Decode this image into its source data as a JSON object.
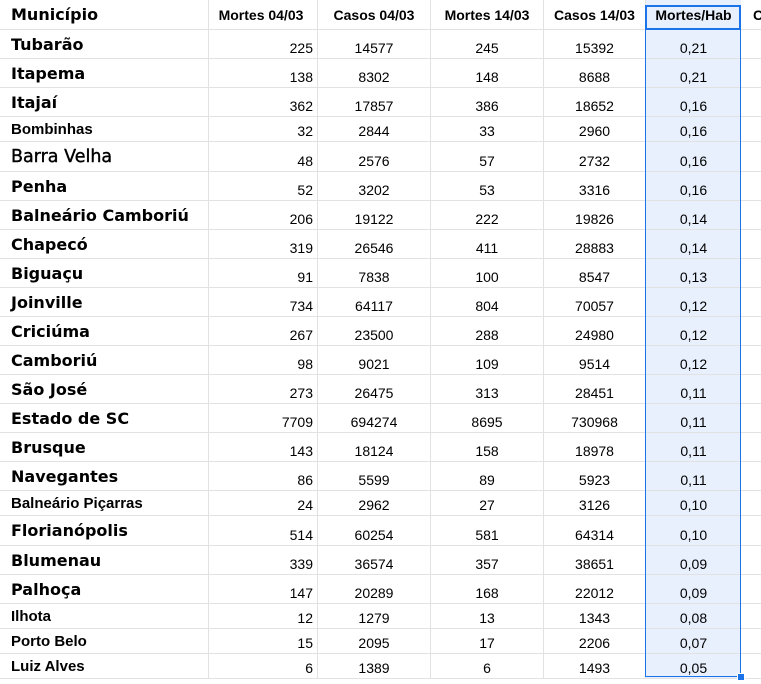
{
  "table": {
    "headers": {
      "municipio": "Município",
      "mortes_0403": "Mortes 04/03",
      "casos_0403": "Casos 04/03",
      "mortes_1403": "Mortes 14/03",
      "casos_1403": "Casos 14/03",
      "mortes_hab": "Mortes/Hab",
      "next": "C"
    },
    "rows": [
      {
        "municipio": "Tubarão",
        "mortes_0403": "225",
        "casos_0403": "14577",
        "mortes_1403": "245",
        "casos_1403": "15392",
        "mortes_hab": "0,21"
      },
      {
        "municipio": "Itapema",
        "mortes_0403": "138",
        "casos_0403": "8302",
        "mortes_1403": "148",
        "casos_1403": "8688",
        "mortes_hab": "0,21"
      },
      {
        "municipio": "Itajaí",
        "mortes_0403": "362",
        "casos_0403": "17857",
        "mortes_1403": "386",
        "casos_1403": "18652",
        "mortes_hab": "0,16"
      },
      {
        "municipio": "Bombinhas",
        "mortes_0403": "32",
        "casos_0403": "2844",
        "mortes_1403": "33",
        "casos_1403": "2960",
        "mortes_hab": "0,16"
      },
      {
        "municipio": "Barra Velha",
        "mortes_0403": "48",
        "casos_0403": "2576",
        "mortes_1403": "57",
        "casos_1403": "2732",
        "mortes_hab": "0,16"
      },
      {
        "municipio": "Penha",
        "mortes_0403": "52",
        "casos_0403": "3202",
        "mortes_1403": "53",
        "casos_1403": "3316",
        "mortes_hab": "0,16"
      },
      {
        "municipio": "Balneário Camboriú",
        "mortes_0403": "206",
        "casos_0403": "19122",
        "mortes_1403": "222",
        "casos_1403": "19826",
        "mortes_hab": "0,14"
      },
      {
        "municipio": "Chapecó",
        "mortes_0403": "319",
        "casos_0403": "26546",
        "mortes_1403": "411",
        "casos_1403": "28883",
        "mortes_hab": "0,14"
      },
      {
        "municipio": "Biguaçu",
        "mortes_0403": "91",
        "casos_0403": "7838",
        "mortes_1403": "100",
        "casos_1403": "8547",
        "mortes_hab": "0,13"
      },
      {
        "municipio": "Joinville",
        "mortes_0403": "734",
        "casos_0403": "64117",
        "mortes_1403": "804",
        "casos_1403": "70057",
        "mortes_hab": "0,12"
      },
      {
        "municipio": "Criciúma",
        "mortes_0403": "267",
        "casos_0403": "23500",
        "mortes_1403": "288",
        "casos_1403": "24980",
        "mortes_hab": "0,12"
      },
      {
        "municipio": "Camboriú",
        "mortes_0403": "98",
        "casos_0403": "9021",
        "mortes_1403": "109",
        "casos_1403": "9514",
        "mortes_hab": "0,12"
      },
      {
        "municipio": "São José",
        "mortes_0403": "273",
        "casos_0403": "26475",
        "mortes_1403": "313",
        "casos_1403": "28451",
        "mortes_hab": "0,11"
      },
      {
        "municipio": "Estado de SC",
        "mortes_0403": "7709",
        "casos_0403": "694274",
        "mortes_1403": "8695",
        "casos_1403": "730968",
        "mortes_hab": "0,11"
      },
      {
        "municipio": "Brusque",
        "mortes_0403": "143",
        "casos_0403": "18124",
        "mortes_1403": "158",
        "casos_1403": "18978",
        "mortes_hab": "0,11"
      },
      {
        "municipio": "Navegantes",
        "mortes_0403": "86",
        "casos_0403": "5599",
        "mortes_1403": "89",
        "casos_1403": "5923",
        "mortes_hab": "0,11"
      },
      {
        "municipio": "Balneário Piçarras",
        "mortes_0403": "24",
        "casos_0403": "2962",
        "mortes_1403": "27",
        "casos_1403": "3126",
        "mortes_hab": "0,10"
      },
      {
        "municipio": "Florianópolis",
        "mortes_0403": "514",
        "casos_0403": "60254",
        "mortes_1403": "581",
        "casos_1403": "64314",
        "mortes_hab": "0,10"
      },
      {
        "municipio": "Blumenau",
        "mortes_0403": "339",
        "casos_0403": "36574",
        "mortes_1403": "357",
        "casos_1403": "38651",
        "mortes_hab": "0,09"
      },
      {
        "municipio": "Palhoça",
        "mortes_0403": "147",
        "casos_0403": "20289",
        "mortes_1403": "168",
        "casos_1403": "22012",
        "mortes_hab": "0,09"
      },
      {
        "municipio": "Ilhota",
        "mortes_0403": "12",
        "casos_0403": "1279",
        "mortes_1403": "13",
        "casos_1403": "1343",
        "mortes_hab": "0,08"
      },
      {
        "municipio": "Porto Belo",
        "mortes_0403": "15",
        "casos_0403": "2095",
        "mortes_1403": "17",
        "casos_1403": "2206",
        "mortes_hab": "0,07"
      },
      {
        "municipio": "Luiz Alves",
        "mortes_0403": "6",
        "casos_0403": "1389",
        "mortes_1403": "6",
        "casos_1403": "1493",
        "mortes_hab": "0,05"
      }
    ]
  },
  "selection": {
    "column": "Mortes/Hab",
    "color": "#1a73e8",
    "fill": "#e8f0fd"
  }
}
